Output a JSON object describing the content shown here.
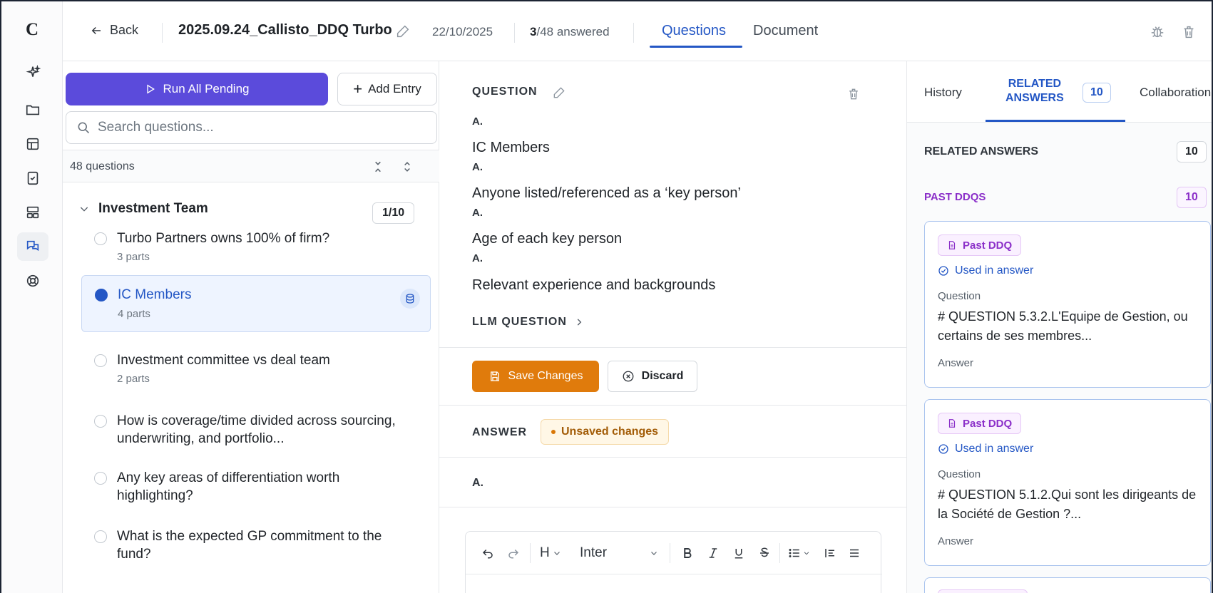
{
  "app": {
    "logo": "C"
  },
  "rail": {
    "icons": [
      "sparkle-icon",
      "folder-icon",
      "table-icon",
      "document-check-icon",
      "layout-icon",
      "chat-icon",
      "lifebuoy-icon"
    ]
  },
  "topbar": {
    "back_label": "Back",
    "title": "2025.09.24_Callisto_DDQ Turbo",
    "date": "22/10/2025",
    "answered_count": "3",
    "answered_suffix": "/48 answered",
    "tabs": [
      {
        "label": "Questions"
      },
      {
        "label": "Document"
      }
    ]
  },
  "questions_panel": {
    "run_all_label": "Run All Pending",
    "add_entry_label": "Add Entry",
    "search_placeholder": "Search questions...",
    "count_label": "48 questions",
    "group": {
      "title": "Investment Team",
      "count": "1/10"
    },
    "items": [
      {
        "text": "Turbo Partners owns 100% of firm?",
        "parts": "3 parts"
      },
      {
        "text": "IC Members",
        "parts": "4 parts"
      },
      {
        "text": "Investment committee vs deal team",
        "parts": "2 parts"
      },
      {
        "text": "How is coverage/time divided across sourcing, underwriting, and portfolio...",
        "parts": ""
      },
      {
        "text": "Any key areas of differentiation worth highlighting?",
        "parts": ""
      },
      {
        "text": "What is the expected GP commitment to the fund?",
        "parts": ""
      }
    ]
  },
  "editor": {
    "question_label": "QUESTION",
    "question_lines": [
      {
        "prefix": "A.",
        "text": "IC Members"
      },
      {
        "prefix": "A.",
        "text": "Anyone listed/referenced as a ‘key person’"
      },
      {
        "prefix": "A.",
        "text": "Age of each key person"
      },
      {
        "prefix": "A.",
        "text": "Relevant experience and backgrounds"
      }
    ],
    "llm_question_label": "LLM QUESTION",
    "save_label": "Save Changes",
    "discard_label": "Discard",
    "answer_label": "ANSWER",
    "unsaved_label": "Unsaved changes",
    "answer_prefix": "A.",
    "font_name": "Inter",
    "heading_label": "H"
  },
  "related": {
    "tabs": {
      "history": "History",
      "related_line1": "RELATED",
      "related_line2": "ANSWERS",
      "related_count": "10",
      "collaboration": "Collaboration"
    },
    "header": "RELATED ANSWERS",
    "header_count": "10",
    "section": "PAST DDQS",
    "section_count": "10",
    "cards": [
      {
        "tag": "Past DDQ",
        "used": "Used in answer",
        "question_label": "Question",
        "question": "# QUESTION 5.3.2.L'Equipe de Gestion, ou certains de ses membres...",
        "answer_label": "Answer"
      },
      {
        "tag": "Past DDQ",
        "used": "Used in answer",
        "question_label": "Question",
        "question": "# QUESTION 5.1.2.Qui sont les dirigeants de la Société de Gestion ?...",
        "answer_label": "Answer"
      }
    ]
  },
  "colors": {
    "primary": "#5b4bdb",
    "accent_blue": "#2457c5",
    "save_orange": "#e07b0c",
    "ddq_purple": "#8b2fc9"
  }
}
